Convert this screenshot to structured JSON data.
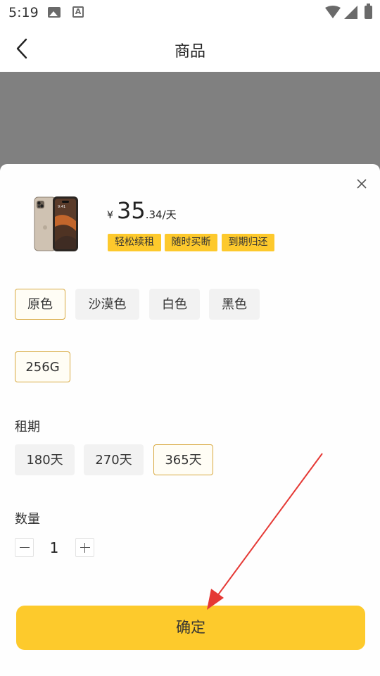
{
  "status_bar": {
    "time": "5:19"
  },
  "header": {
    "title": "商品"
  },
  "product": {
    "price": {
      "currency": "¥",
      "integer": "35",
      "decimal": ".34",
      "unit": "/天"
    },
    "tags": [
      "轻松续租",
      "随时买断",
      "到期归还"
    ]
  },
  "colors": {
    "options": [
      "原色",
      "沙漠色",
      "白色",
      "黑色"
    ],
    "selected": "原色"
  },
  "storage": {
    "options": [
      "256G"
    ],
    "selected": "256G"
  },
  "lease": {
    "label": "租期",
    "options": [
      "180天",
      "270天",
      "365天"
    ],
    "selected": "365天"
  },
  "quantity": {
    "label": "数量",
    "value": "1"
  },
  "confirm": {
    "label": "确定"
  },
  "theme": {
    "accent": "#fdca2c",
    "selected_border": "#d8a940",
    "overlay": "#808080",
    "arrow": "#e53935"
  }
}
